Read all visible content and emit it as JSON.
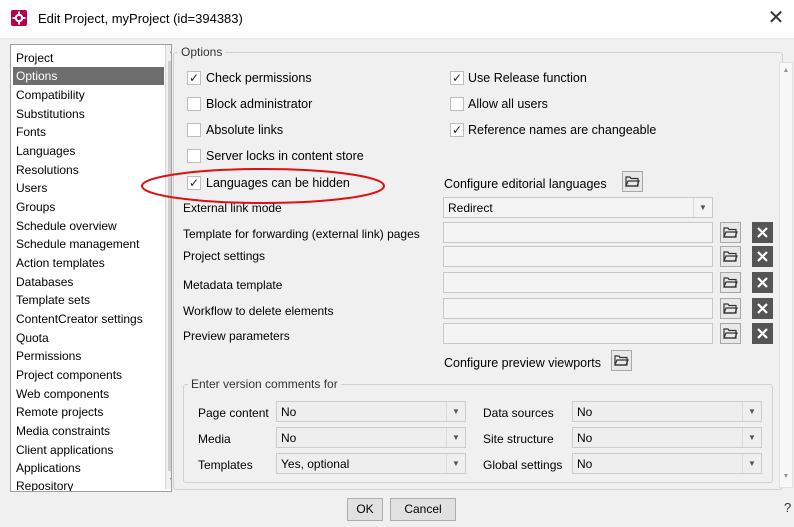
{
  "window": {
    "title": "Edit Project, myProject (id=394383)",
    "close": "✕"
  },
  "nav": {
    "items": [
      "Project",
      "Options",
      "Compatibility",
      "Substitutions",
      "Fonts",
      "Languages",
      "Resolutions",
      "Users",
      "Groups",
      "Schedule overview",
      "Schedule management",
      "Action templates",
      "Databases",
      "Template sets",
      "ContentCreator settings",
      "Quota",
      "Permissions",
      "Project components",
      "Web components",
      "Remote projects",
      "Media constraints",
      "Client applications",
      "Applications",
      "Repository"
    ],
    "selected": "Options"
  },
  "options": {
    "legend": "Options",
    "checkboxes": {
      "check_permissions": {
        "label": "Check permissions",
        "checked": true,
        "mark": "✓"
      },
      "use_release": {
        "label": "Use Release function",
        "checked": true,
        "mark": "✓"
      },
      "block_admin": {
        "label": "Block administrator",
        "checked": false,
        "mark": ""
      },
      "allow_all_users": {
        "label": "Allow all users",
        "checked": false,
        "mark": ""
      },
      "absolute_links": {
        "label": "Absolute links",
        "checked": false,
        "mark": ""
      },
      "reference_names": {
        "label": "Reference names are changeable",
        "checked": true,
        "mark": "✓"
      },
      "server_locks": {
        "label": "Server locks in content store",
        "checked": false,
        "mark": ""
      },
      "languages_hidden": {
        "label": "Languages can be hidden",
        "checked": true,
        "mark": "✓"
      }
    },
    "configure_languages": "Configure editorial languages",
    "external_link_mode": {
      "label": "External link mode",
      "value": "Redirect"
    },
    "fields": {
      "forwarding_template": "Template for forwarding (external link) pages",
      "project_settings": "Project settings",
      "metadata_template": "Metadata template",
      "workflow_delete": "Workflow to delete elements",
      "preview_parameters": "Preview parameters"
    },
    "configure_viewports": "Configure preview viewports"
  },
  "version_comments": {
    "legend": "Enter version comments for",
    "page_content": {
      "label": "Page content",
      "value": "No"
    },
    "media": {
      "label": "Media",
      "value": "No"
    },
    "templates": {
      "label": "Templates",
      "value": "Yes, optional"
    },
    "data_sources": {
      "label": "Data sources",
      "value": "No"
    },
    "site_structure": {
      "label": "Site structure",
      "value": "No"
    },
    "global_settings": {
      "label": "Global settings",
      "value": "No"
    }
  },
  "buttons": {
    "ok": "OK",
    "cancel": "Cancel",
    "help": "?"
  },
  "colors": {
    "app_icon": "#b8004d",
    "selection": "#6e6e6e",
    "highlight_ellipse": "#e01010"
  }
}
